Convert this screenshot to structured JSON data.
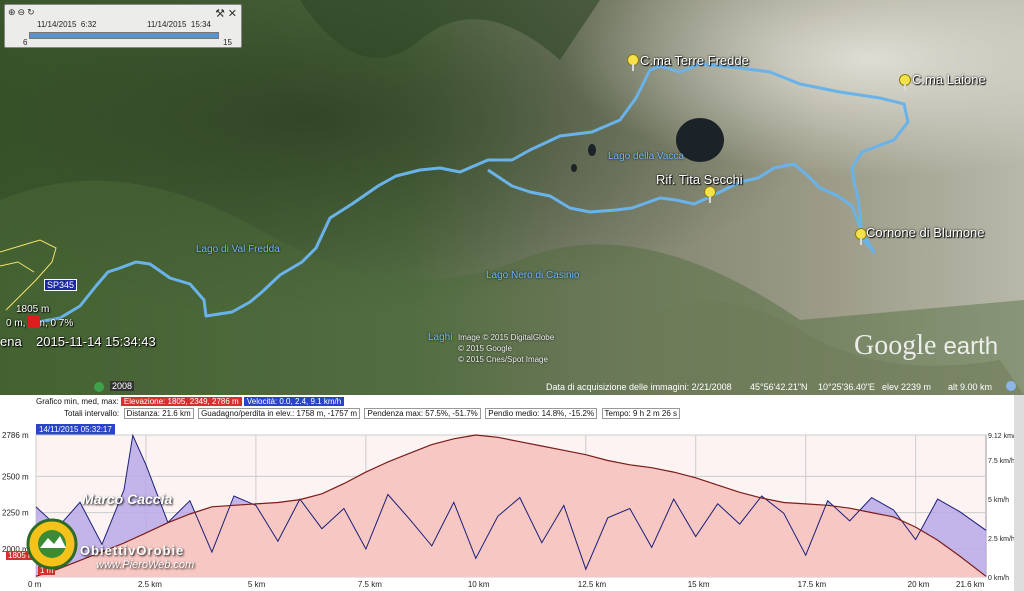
{
  "timebar": {
    "start_label": "11/14/2015",
    "start_time": "6:32",
    "end_label": "11/14/2015",
    "end_time": "15:34",
    "min": "6",
    "max": "15",
    "range_fraction": 1.0
  },
  "map": {
    "peaks": [
      {
        "name": "C.ma Terre Fredde"
      },
      {
        "name": "C.ma Laione"
      },
      {
        "name": "Rif. Tita Secchi"
      },
      {
        "name": "Cornone di Blumone"
      }
    ],
    "lakes": [
      {
        "name": "Lago della Vacca"
      },
      {
        "name": "Lago di Val Fredda"
      },
      {
        "name": "Lago Nero di Casinio"
      },
      {
        "name": "Laghi"
      }
    ],
    "road_label": "SP345",
    "start_marker": {
      "elevation": "1805 m",
      "stats": "0 m, 0 m, 0 7%",
      "timestamp": "2015-11-14 15:34:43",
      "cut_text": "ena"
    },
    "credits": [
      "Image © 2015 DigitalGlobe",
      "© 2015 Google",
      "© 2015 Cnes/Spot Image"
    ],
    "year_badge": "2008",
    "logo_word1": "Google",
    "logo_word2": "earth",
    "status": {
      "acq_date": "Data di acquisizione delle immagini: 2/21/2008",
      "lat": "45°56'42.21\"N",
      "lon": "10°25'36.40\"E",
      "elev": "elev  2239 m",
      "alt": "alt   9.00 km"
    },
    "colors": {
      "track": "#6ab3ea",
      "pin": "#f5e24a"
    }
  },
  "profile": {
    "row1": {
      "prefix": "Grafico  min, med, max:",
      "elevation": "Elevazione: 1805, 2349, 2786 m",
      "speed": "Velocità: 0.0, 2.4, 9.1 km/h"
    },
    "row2": {
      "totals": "Totali intervallo:",
      "distance": "Distanza: 21.6 km",
      "gain": "Guadagno/perdita in elev.:  1758 m, -1757 m",
      "slope": "Pendenza max:  57.5%, -51.7%",
      "avg_slope": "Pendio medio: 14.8%, -15.2%",
      "time": "Tempo: 9 h 2 m 26 s"
    },
    "cursor_date": "14/11/2015 05:32:17",
    "left_axis": [
      "2786 m",
      "2500 m",
      "2250 m",
      "2000 m",
      "1805 m"
    ],
    "right_axis": [
      "9.12 km/h",
      "7.5 km/h",
      "5 km/h",
      "2.5 km/h",
      "0 km/h"
    ],
    "x_ticks": [
      "0 m",
      "2.5 km",
      "5 km",
      "7.5 km",
      "10 km",
      "12.5 km",
      "15 km",
      "17.5 km",
      "20 km",
      "21.6 km"
    ],
    "left_marker_low": "1 m",
    "signature": "Marco Caccia",
    "brand": "ObiettivOrobie",
    "site": "www.PieroWeb.com",
    "colors": {
      "elevation_fill": "#f7c7c3",
      "elevation_line": "#7a1c1a",
      "speed_fill": "#b9a8e8",
      "speed_line": "#1a1f7a"
    }
  },
  "chart_data": {
    "type": "area",
    "title": "",
    "xlabel": "",
    "ylabel": "",
    "x_unit": "km",
    "xlim": [
      0,
      21.6
    ],
    "ylim": [
      1805,
      2786
    ],
    "y2lim": [
      0,
      9.12
    ],
    "series": [
      {
        "name": "Elevazione",
        "unit": "m",
        "x": [
          0,
          0.5,
          1,
          1.5,
          2,
          2.5,
          3,
          3.5,
          4,
          4.5,
          5,
          5.5,
          6,
          6.5,
          7,
          7.5,
          8,
          8.5,
          9,
          9.5,
          10,
          10.5,
          11,
          11.5,
          12,
          12.5,
          13,
          13.5,
          14,
          14.5,
          15,
          15.5,
          16,
          16.5,
          17,
          17.5,
          18,
          18.5,
          19,
          19.5,
          20,
          20.5,
          21,
          21.6
        ],
        "values": [
          1810,
          1860,
          1920,
          1980,
          2040,
          2110,
          2180,
          2240,
          2290,
          2300,
          2310,
          2320,
          2340,
          2380,
          2450,
          2530,
          2600,
          2660,
          2720,
          2760,
          2786,
          2770,
          2740,
          2710,
          2680,
          2650,
          2610,
          2580,
          2560,
          2530,
          2490,
          2440,
          2390,
          2350,
          2320,
          2310,
          2300,
          2280,
          2250,
          2220,
          2150,
          2060,
          1950,
          1810
        ]
      },
      {
        "name": "Velocità",
        "unit": "km/h",
        "x": [
          0,
          0.5,
          1,
          1.5,
          2,
          2.2,
          2.5,
          3,
          3.5,
          4,
          4.5,
          5,
          5.5,
          6,
          6.5,
          7,
          7.5,
          8,
          8.5,
          9,
          9.5,
          10,
          10.5,
          11,
          11.5,
          12,
          12.5,
          13,
          13.5,
          14,
          14.5,
          15,
          15.5,
          16,
          16.5,
          17,
          17.5,
          18,
          18.5,
          19,
          19.5,
          20,
          20.5,
          21,
          21.6
        ],
        "values": [
          4.5,
          3.2,
          4.8,
          2.1,
          5.6,
          9.1,
          7.2,
          3.5,
          4.9,
          1.6,
          5.2,
          4.6,
          2.3,
          5.0,
          3.1,
          4.4,
          1.8,
          5.3,
          3.7,
          2.0,
          4.8,
          1.2,
          3.9,
          5.1,
          2.2,
          4.6,
          0.5,
          3.8,
          4.4,
          1.9,
          5.0,
          2.6,
          4.7,
          3.4,
          5.2,
          4.1,
          1.4,
          4.9,
          3.6,
          5.1,
          4.3,
          2.4,
          5.0,
          4.2,
          3.0
        ]
      }
    ],
    "grid": true
  }
}
